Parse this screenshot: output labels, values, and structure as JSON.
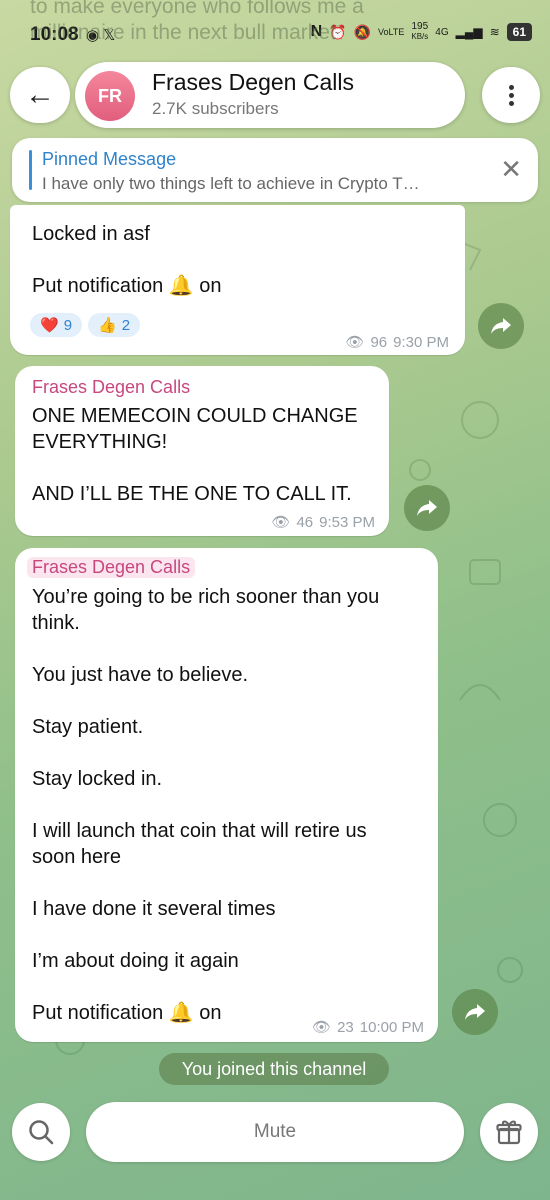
{
  "status_bar": {
    "time": "10:08",
    "left_icons": [
      "messenger-icon",
      "x-icon"
    ],
    "network": "VoLTE",
    "speed": "195",
    "speed_unit": "KB/s",
    "signal_type": "4G",
    "battery": "61"
  },
  "behind_text": [
    "to make everyone who follows me a",
    "millionaire in the next bull market"
  ],
  "header": {
    "avatar_initials": "FR",
    "channel_name": "Frases Degen Calls",
    "subscribers": "2.7K subscribers"
  },
  "pinned": {
    "title": "Pinned Message",
    "text": "I have only two things left to achieve in Crypto T…"
  },
  "messages": [
    {
      "text": "Locked in asf\n\nPut notification 🔔 on",
      "reactions": [
        {
          "emoji": "❤️",
          "count": "9"
        },
        {
          "emoji": "👍",
          "count": "2"
        }
      ],
      "views": "96",
      "time": "9:30 PM"
    },
    {
      "sender": "Frases Degen Calls",
      "text": "ONE MEMECOIN COULD CHANGE\nEVERYTHING!\n\nAND I’LL BE THE ONE TO CALL IT.",
      "views": "46",
      "time": "9:53 PM"
    },
    {
      "sender": "Frases Degen Calls",
      "text": "You’re going to be rich sooner than you\nthink.\n\nYou just have to believe.\n\nStay patient.\n\nStay locked in.\n\nI will launch that coin that will retire us\nsoon here\n\nI have done it several times\n\nI’m about doing it again\n\nPut notification 🔔 on",
      "views": "23",
      "time": "10:00 PM"
    }
  ],
  "service_message": "You joined this channel",
  "bottom": {
    "mute_label": "Mute"
  }
}
